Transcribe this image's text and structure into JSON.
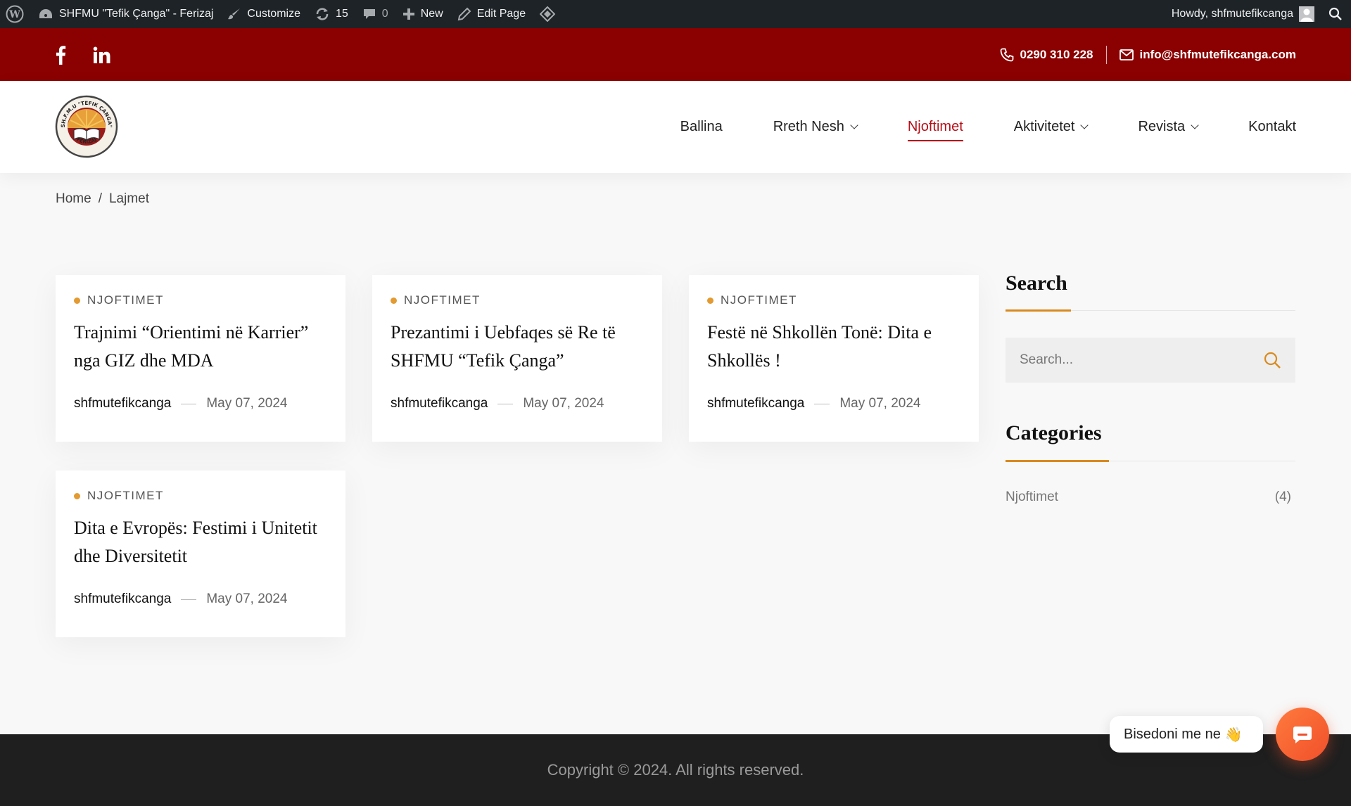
{
  "adminbar": {
    "site_name": "SHFMU \"Tefik Çanga\" - Ferizaj",
    "customize": "Customize",
    "updates_count": "15",
    "comments_count": "0",
    "new": "New",
    "edit_page": "Edit Page",
    "howdy": "Howdy, shfmutefikcanga"
  },
  "topbar": {
    "phone": "0290 310 228",
    "email": "info@shfmutefikcanga.com"
  },
  "logo": {
    "top_text": "SH.F.M.U \"TEFIK ÇANGA\"",
    "bottom_text": "FERIZAJ"
  },
  "nav": {
    "items": [
      {
        "label": "Ballina"
      },
      {
        "label": "Rreth Nesh"
      },
      {
        "label": "Njoftimet"
      },
      {
        "label": "Aktivitetet"
      },
      {
        "label": "Revista"
      },
      {
        "label": "Kontakt"
      }
    ]
  },
  "breadcrumb": {
    "home": "Home",
    "separator": "/",
    "current": "Lajmet"
  },
  "posts": [
    {
      "category": "NJOFTIMET",
      "title": "Trajnimi “Orientimi në Karrier” nga GIZ dhe MDA",
      "author": "shfmutefikcanga",
      "date": "May 07, 2024"
    },
    {
      "category": "NJOFTIMET",
      "title": "Prezantimi i Uebfaqes së Re të SHFMU “Tefik Çanga”",
      "author": "shfmutefikcanga",
      "date": "May 07, 2024"
    },
    {
      "category": "NJOFTIMET",
      "title": "Festë në Shkollën Tonë: Dita e Shkollës !",
      "author": "shfmutefikcanga",
      "date": "May 07, 2024"
    },
    {
      "category": "NJOFTIMET",
      "title": "Dita e Evropës: Festimi i Unitetit dhe Diversitetit",
      "author": "shfmutefikcanga",
      "date": "May 07, 2024"
    }
  ],
  "sidebar": {
    "search_title": "Search",
    "search_placeholder": "Search...",
    "categories_title": "Categories",
    "categories": [
      {
        "name": "Njoftimet",
        "count": "(4)"
      }
    ]
  },
  "footer": {
    "copyright": "Copyright © 2024. All rights reserved."
  },
  "chat": {
    "bubble_text": "Bisedoni me ne",
    "emoji": "👋"
  },
  "colors": {
    "topbar": "#8b0000",
    "accent": "#d98a1f",
    "nav_active": "#b4101a",
    "chat": "#f0502a"
  }
}
